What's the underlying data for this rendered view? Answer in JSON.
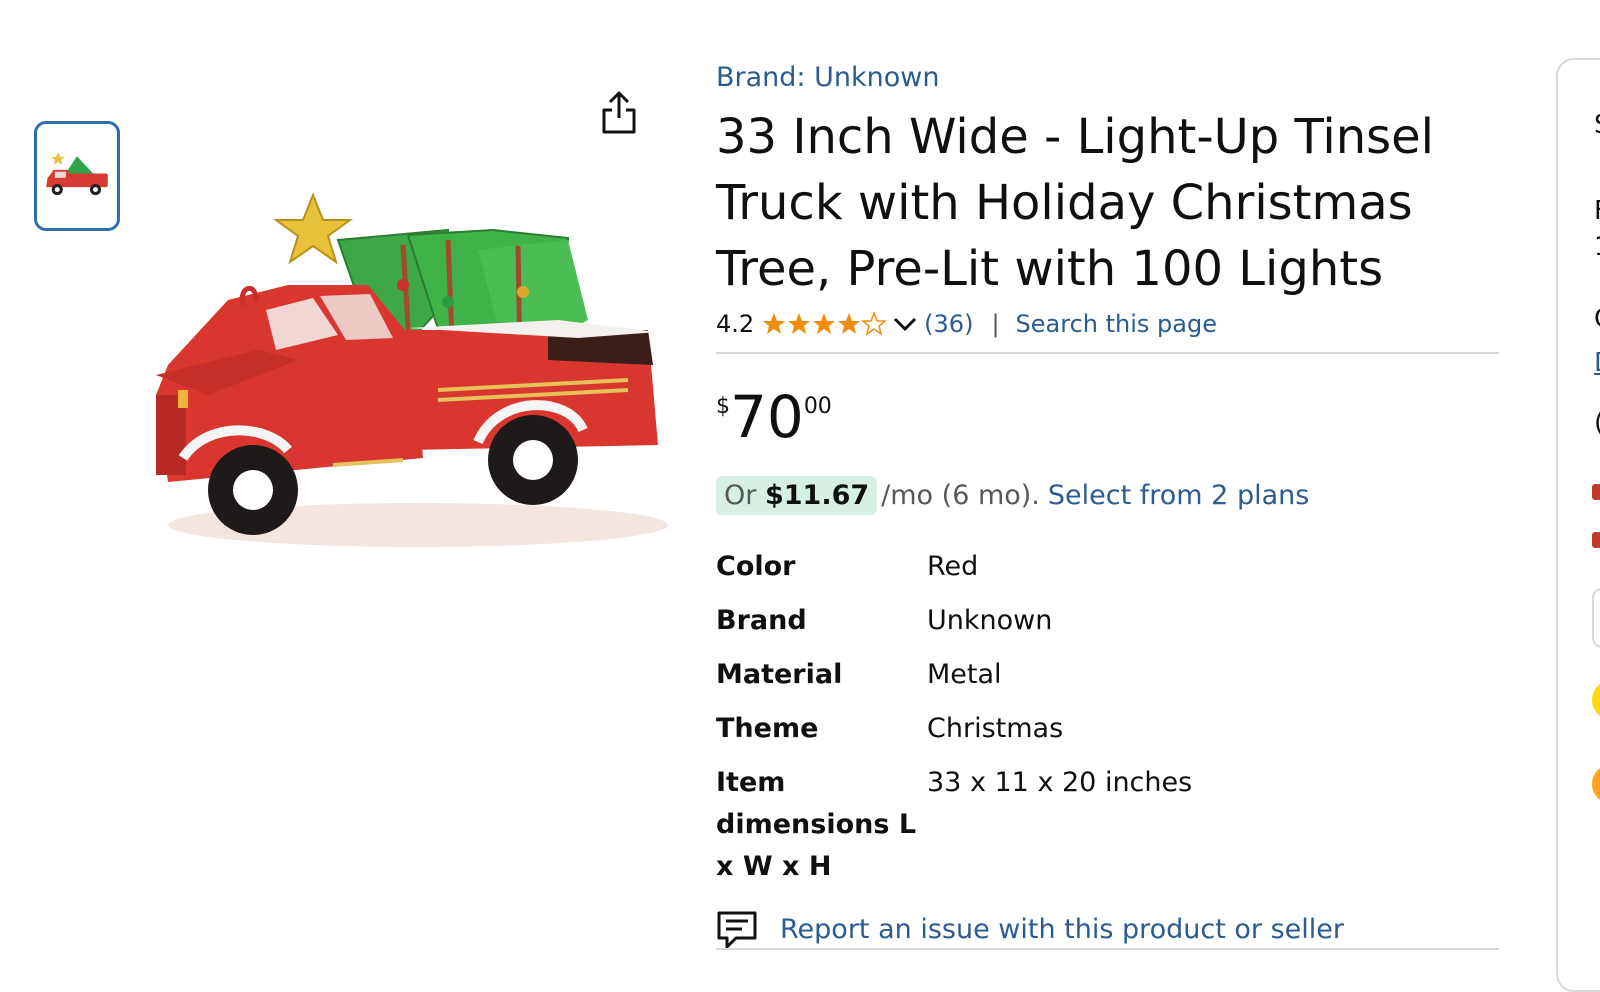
{
  "product": {
    "brand_link": "Brand: Unknown",
    "title_lines": [
      "33 Inch Wide - Light-Up Tinsel",
      "Truck with Holiday Christmas",
      "Tree, Pre-Lit with 100 Lights"
    ],
    "rating": {
      "value": "4.2",
      "stars": 4.2,
      "count": "(36)",
      "separator": "|",
      "search_link": "Search this page"
    },
    "price": {
      "currency": "$",
      "whole": "70",
      "fraction": "00"
    },
    "installment": {
      "prefix": "Or",
      "amount": "$11.67",
      "suffix": "/mo (6 mo).",
      "link": "Select from 2 plans"
    },
    "specs": [
      {
        "key": "Color",
        "value": "Red"
      },
      {
        "key": "Brand",
        "value": "Unknown"
      },
      {
        "key": "Material",
        "value": "Metal"
      },
      {
        "key": "Theme",
        "value": "Christmas"
      },
      {
        "key": "Item dimensions L x W x H",
        "value": "33 x 11 x 20 inches"
      }
    ],
    "report_link": "Report an issue with this product or seller"
  },
  "right_panel_glyphs": [
    "S",
    "F",
    "1",
    "C",
    "D",
    "("
  ],
  "colors": {
    "link": "#2a5c8f",
    "star": "#f08d0c",
    "installment_bg": "#d6f1e3",
    "thumb_border": "#2f6fb0"
  },
  "icons": [
    "share-icon",
    "chevron-down-icon",
    "star-icon",
    "report-icon"
  ]
}
